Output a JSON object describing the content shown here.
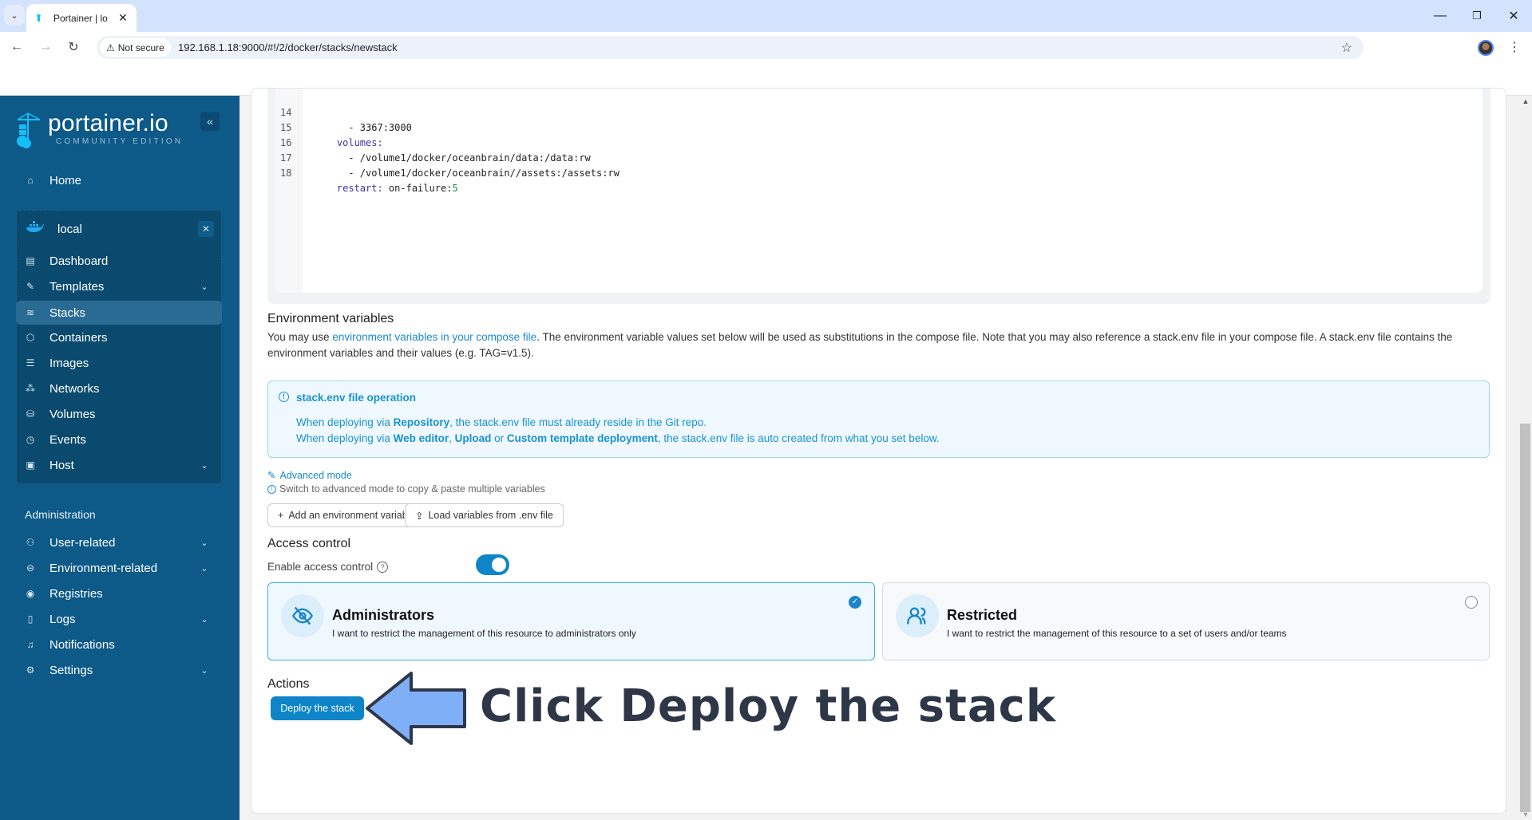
{
  "browser": {
    "tab_title": "Portainer | lo",
    "security_label": "Not secure",
    "url": "192.168.1.18:9000/#!/2/docker/stacks/newstack"
  },
  "sidebar": {
    "logo_main": "portainer.io",
    "logo_sub": "COMMUNITY EDITION",
    "collapse_icon": "«",
    "home_label": "Home",
    "environment": {
      "name": "local"
    },
    "env_items": [
      {
        "label": "Dashboard",
        "icon": "dashboard-icon"
      },
      {
        "label": "Templates",
        "icon": "edit-icon",
        "expandable": true
      },
      {
        "label": "Stacks",
        "icon": "layers-icon",
        "active": true
      },
      {
        "label": "Containers",
        "icon": "box-icon"
      },
      {
        "label": "Images",
        "icon": "list-icon"
      },
      {
        "label": "Networks",
        "icon": "network-icon"
      },
      {
        "label": "Volumes",
        "icon": "database-icon"
      },
      {
        "label": "Events",
        "icon": "clock-icon"
      },
      {
        "label": "Host",
        "icon": "host-icon",
        "expandable": true
      }
    ],
    "admin_label": "Administration",
    "admin_items": [
      {
        "label": "User-related",
        "icon": "users-icon",
        "expandable": true
      },
      {
        "label": "Environment-related",
        "icon": "drive-icon",
        "expandable": true
      },
      {
        "label": "Registries",
        "icon": "broadcast-icon"
      },
      {
        "label": "Logs",
        "icon": "file-icon",
        "expandable": true
      },
      {
        "label": "Notifications",
        "icon": "bell-icon"
      },
      {
        "label": "Settings",
        "icon": "gear-icon",
        "expandable": true
      }
    ]
  },
  "editor": {
    "lines": [
      {
        "n": "14",
        "text": "      - 3367:3000"
      },
      {
        "n": "15",
        "text": "    volumes:"
      },
      {
        "n": "16",
        "text": "      - /volume1/docker/oceanbrain/data:/data:rw"
      },
      {
        "n": "17",
        "text": "      - /volume1/docker/oceanbrain//assets:/assets:rw"
      },
      {
        "n": "18",
        "text": "    restart: on-failure:5"
      }
    ]
  },
  "env_vars": {
    "title": "Environment variables",
    "para_prefix": "You may use ",
    "para_link": "environment variables in your compose file",
    "para_suffix": ". The environment variable values set below will be used as substitutions in the compose file. Note that you may also reference a stack.env file in your compose file. A stack.env file contains the environment variables and their values (e.g. TAG=v1.5).",
    "info_title": "stack.env file operation",
    "info_line1": {
      "a": "When deploying via ",
      "b1": "Repository",
      "c": ", the stack.env file must already reside in the Git repo."
    },
    "info_line2": {
      "a": "When deploying via ",
      "b1": "Web editor",
      "sep1": ", ",
      "b2": "Upload",
      "sep2": " or ",
      "b3": "Custom template deployment",
      "c": ", the stack.env file is auto created from what you set below."
    },
    "advanced_mode": "Advanced mode",
    "advanced_hint": "Switch to advanced mode to copy & paste multiple variables",
    "add_button": "Add an environment variable",
    "load_button": "Load variables from .env file"
  },
  "access_control": {
    "title": "Access control",
    "toggle_label": "Enable access control",
    "toggle_on": true,
    "options": [
      {
        "title": "Administrators",
        "desc": "I want to restrict the management of this resource to administrators only",
        "selected": true
      },
      {
        "title": "Restricted",
        "desc": "I want to restrict the management of this resource to a set of users and/or teams",
        "selected": false
      }
    ]
  },
  "actions": {
    "title": "Actions",
    "deploy_button": "Deploy the stack"
  },
  "annotation": {
    "text": "Click Deploy the stack"
  },
  "colors": {
    "sidebar_bg": "#0d5987",
    "accent": "#0d85c8",
    "annotation_arrow": "#7fb0f7"
  }
}
